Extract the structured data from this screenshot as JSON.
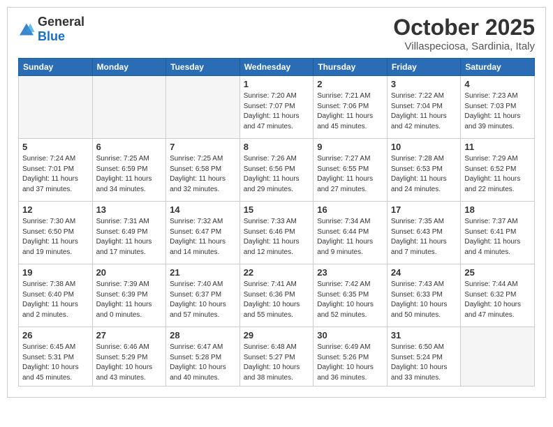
{
  "header": {
    "logo": {
      "text_general": "General",
      "text_blue": "Blue"
    },
    "title": "October 2025",
    "subtitle": "Villaspeciosa, Sardinia, Italy"
  },
  "weekdays": [
    "Sunday",
    "Monday",
    "Tuesday",
    "Wednesday",
    "Thursday",
    "Friday",
    "Saturday"
  ],
  "weeks": [
    [
      {
        "day": "",
        "info": ""
      },
      {
        "day": "",
        "info": ""
      },
      {
        "day": "",
        "info": ""
      },
      {
        "day": "1",
        "info": "Sunrise: 7:20 AM\nSunset: 7:07 PM\nDaylight: 11 hours\nand 47 minutes."
      },
      {
        "day": "2",
        "info": "Sunrise: 7:21 AM\nSunset: 7:06 PM\nDaylight: 11 hours\nand 45 minutes."
      },
      {
        "day": "3",
        "info": "Sunrise: 7:22 AM\nSunset: 7:04 PM\nDaylight: 11 hours\nand 42 minutes."
      },
      {
        "day": "4",
        "info": "Sunrise: 7:23 AM\nSunset: 7:03 PM\nDaylight: 11 hours\nand 39 minutes."
      }
    ],
    [
      {
        "day": "5",
        "info": "Sunrise: 7:24 AM\nSunset: 7:01 PM\nDaylight: 11 hours\nand 37 minutes."
      },
      {
        "day": "6",
        "info": "Sunrise: 7:25 AM\nSunset: 6:59 PM\nDaylight: 11 hours\nand 34 minutes."
      },
      {
        "day": "7",
        "info": "Sunrise: 7:25 AM\nSunset: 6:58 PM\nDaylight: 11 hours\nand 32 minutes."
      },
      {
        "day": "8",
        "info": "Sunrise: 7:26 AM\nSunset: 6:56 PM\nDaylight: 11 hours\nand 29 minutes."
      },
      {
        "day": "9",
        "info": "Sunrise: 7:27 AM\nSunset: 6:55 PM\nDaylight: 11 hours\nand 27 minutes."
      },
      {
        "day": "10",
        "info": "Sunrise: 7:28 AM\nSunset: 6:53 PM\nDaylight: 11 hours\nand 24 minutes."
      },
      {
        "day": "11",
        "info": "Sunrise: 7:29 AM\nSunset: 6:52 PM\nDaylight: 11 hours\nand 22 minutes."
      }
    ],
    [
      {
        "day": "12",
        "info": "Sunrise: 7:30 AM\nSunset: 6:50 PM\nDaylight: 11 hours\nand 19 minutes."
      },
      {
        "day": "13",
        "info": "Sunrise: 7:31 AM\nSunset: 6:49 PM\nDaylight: 11 hours\nand 17 minutes."
      },
      {
        "day": "14",
        "info": "Sunrise: 7:32 AM\nSunset: 6:47 PM\nDaylight: 11 hours\nand 14 minutes."
      },
      {
        "day": "15",
        "info": "Sunrise: 7:33 AM\nSunset: 6:46 PM\nDaylight: 11 hours\nand 12 minutes."
      },
      {
        "day": "16",
        "info": "Sunrise: 7:34 AM\nSunset: 6:44 PM\nDaylight: 11 hours\nand 9 minutes."
      },
      {
        "day": "17",
        "info": "Sunrise: 7:35 AM\nSunset: 6:43 PM\nDaylight: 11 hours\nand 7 minutes."
      },
      {
        "day": "18",
        "info": "Sunrise: 7:37 AM\nSunset: 6:41 PM\nDaylight: 11 hours\nand 4 minutes."
      }
    ],
    [
      {
        "day": "19",
        "info": "Sunrise: 7:38 AM\nSunset: 6:40 PM\nDaylight: 11 hours\nand 2 minutes."
      },
      {
        "day": "20",
        "info": "Sunrise: 7:39 AM\nSunset: 6:39 PM\nDaylight: 11 hours\nand 0 minutes."
      },
      {
        "day": "21",
        "info": "Sunrise: 7:40 AM\nSunset: 6:37 PM\nDaylight: 10 hours\nand 57 minutes."
      },
      {
        "day": "22",
        "info": "Sunrise: 7:41 AM\nSunset: 6:36 PM\nDaylight: 10 hours\nand 55 minutes."
      },
      {
        "day": "23",
        "info": "Sunrise: 7:42 AM\nSunset: 6:35 PM\nDaylight: 10 hours\nand 52 minutes."
      },
      {
        "day": "24",
        "info": "Sunrise: 7:43 AM\nSunset: 6:33 PM\nDaylight: 10 hours\nand 50 minutes."
      },
      {
        "day": "25",
        "info": "Sunrise: 7:44 AM\nSunset: 6:32 PM\nDaylight: 10 hours\nand 47 minutes."
      }
    ],
    [
      {
        "day": "26",
        "info": "Sunrise: 6:45 AM\nSunset: 5:31 PM\nDaylight: 10 hours\nand 45 minutes."
      },
      {
        "day": "27",
        "info": "Sunrise: 6:46 AM\nSunset: 5:29 PM\nDaylight: 10 hours\nand 43 minutes."
      },
      {
        "day": "28",
        "info": "Sunrise: 6:47 AM\nSunset: 5:28 PM\nDaylight: 10 hours\nand 40 minutes."
      },
      {
        "day": "29",
        "info": "Sunrise: 6:48 AM\nSunset: 5:27 PM\nDaylight: 10 hours\nand 38 minutes."
      },
      {
        "day": "30",
        "info": "Sunrise: 6:49 AM\nSunset: 5:26 PM\nDaylight: 10 hours\nand 36 minutes."
      },
      {
        "day": "31",
        "info": "Sunrise: 6:50 AM\nSunset: 5:24 PM\nDaylight: 10 hours\nand 33 minutes."
      },
      {
        "day": "",
        "info": ""
      }
    ]
  ]
}
